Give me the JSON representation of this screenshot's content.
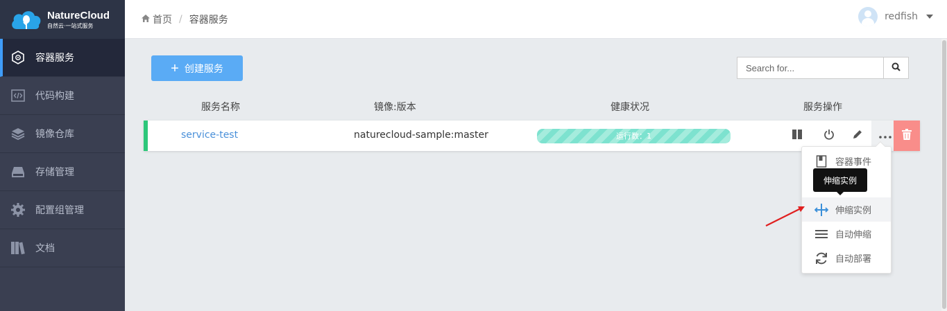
{
  "brand": {
    "name": "NatureCloud",
    "tagline": "自然云·一站式服务"
  },
  "sidebar": {
    "items": [
      {
        "label": "容器服务",
        "icon": "container-icon",
        "active": true
      },
      {
        "label": "代码构建",
        "icon": "code-icon",
        "active": false
      },
      {
        "label": "镜像仓库",
        "icon": "layers-icon",
        "active": false
      },
      {
        "label": "存储管理",
        "icon": "storage-icon",
        "active": false
      },
      {
        "label": "配置组管理",
        "icon": "gear-icon",
        "active": false
      },
      {
        "label": "文档",
        "icon": "books-icon",
        "active": false
      }
    ]
  },
  "topbar": {
    "breadcrumb": {
      "home": "首页",
      "separator": "/",
      "current": "容器服务"
    },
    "user": {
      "name": "redfish"
    }
  },
  "main": {
    "create_button": "创建服务",
    "search": {
      "placeholder": "Search for..."
    },
    "columns": [
      "服务名称",
      "镜像:版本",
      "健康状况",
      "服务操作"
    ],
    "services": [
      {
        "name": "service-test",
        "image": "naturecloud-sample:master",
        "health": "运行数：1",
        "status_color": "#2dc77a"
      }
    ],
    "dropdown": {
      "items": [
        {
          "label": "容器事件",
          "icon": "book-icon"
        },
        {
          "label": "",
          "icon": "list-icon"
        },
        {
          "label": "伸缩实例",
          "icon": "scale-arrows-icon",
          "hover": true
        },
        {
          "label": "自动伸缩",
          "icon": "menu-lines-icon"
        },
        {
          "label": "自动部署",
          "icon": "refresh-icon"
        }
      ],
      "tooltip": "伸缩实例"
    }
  },
  "colors": {
    "accent": "#5aabf5",
    "danger": "#f98d8a",
    "running": "#7de2cf"
  }
}
